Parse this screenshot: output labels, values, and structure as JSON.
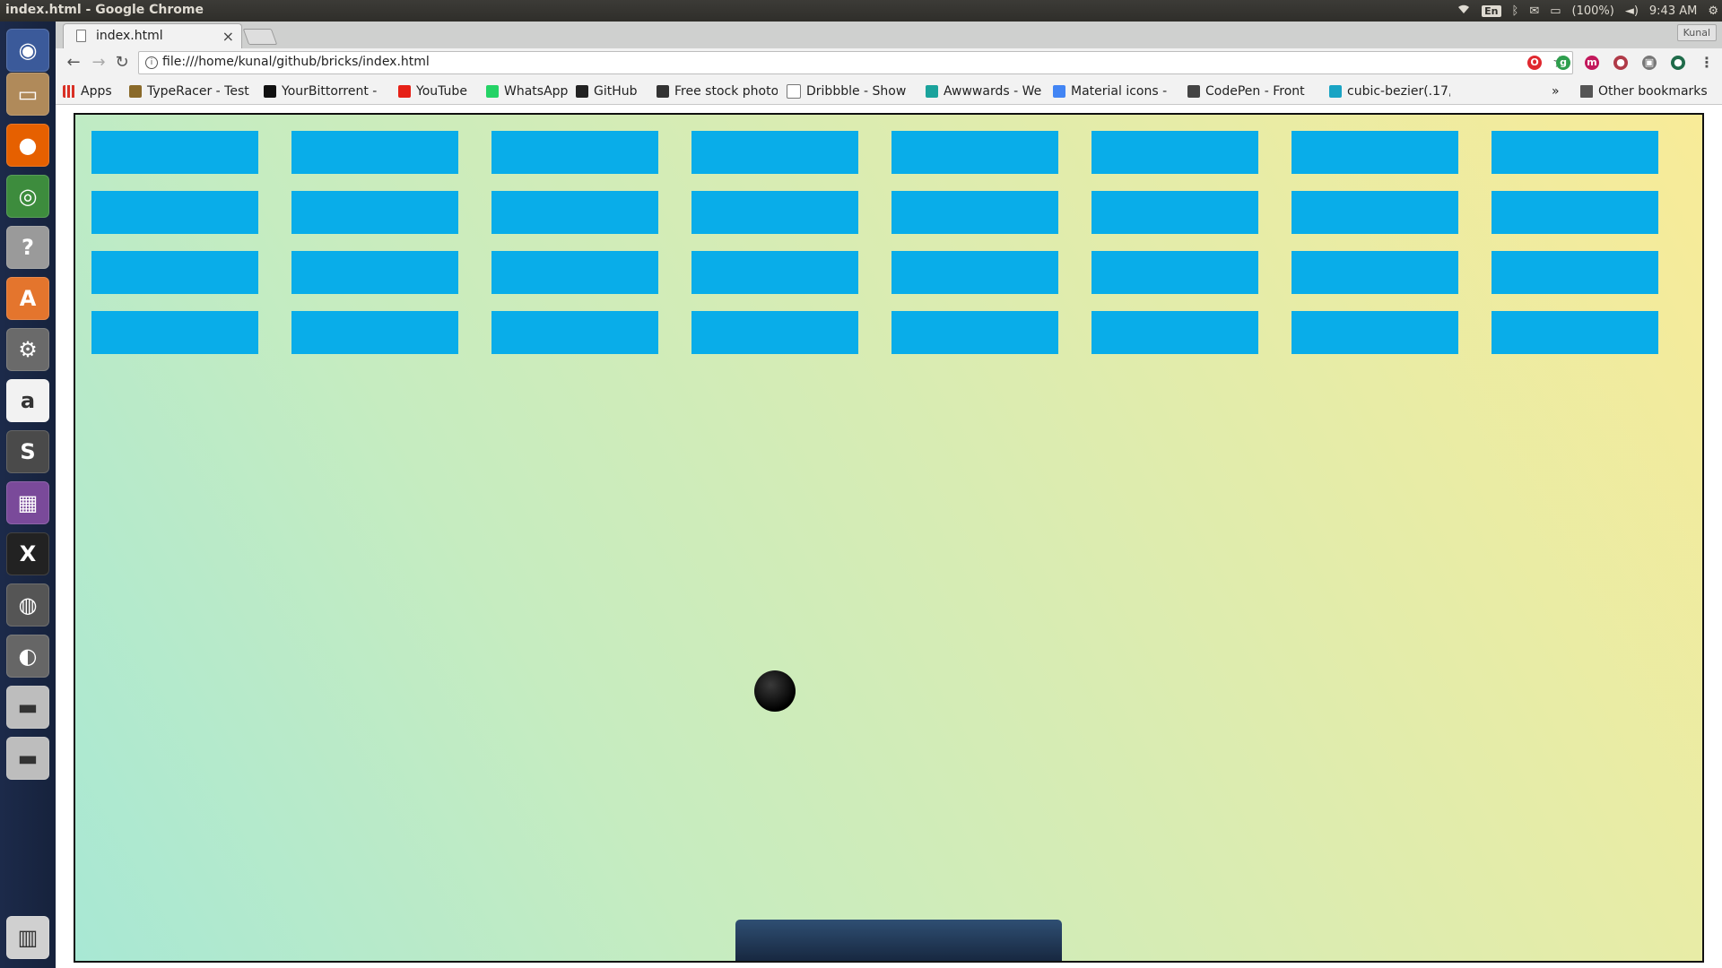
{
  "window_title": "index.html - Google Chrome",
  "system_tray": {
    "keyboard_layout": "En",
    "battery": "(100%)",
    "time": "9:43 AM",
    "user": "Kunal"
  },
  "launcher": {
    "items": [
      {
        "name": "ubuntu-dash-icon",
        "glyph": "◉",
        "color": "#3b5a9a"
      },
      {
        "name": "files-icon",
        "glyph": "▭",
        "color": "#b08a5a"
      },
      {
        "name": "firefox-icon",
        "glyph": "●",
        "color": "#e66000"
      },
      {
        "name": "chrome-icon",
        "glyph": "◎",
        "color": "#3d8c3d"
      },
      {
        "name": "help-icon",
        "glyph": "?",
        "color": "#9a9a9a"
      },
      {
        "name": "software-center-icon",
        "glyph": "A",
        "color": "#e4752d"
      },
      {
        "name": "system-settings-icon",
        "glyph": "⚙",
        "color": "#6a6a6a"
      },
      {
        "name": "amazon-icon",
        "glyph": "a",
        "color": "#f2f2f2"
      },
      {
        "name": "sublime-text-icon",
        "glyph": "S",
        "color": "#4a4a4a"
      },
      {
        "name": "video-editor-icon",
        "glyph": "▦",
        "color": "#7a4a9a"
      },
      {
        "name": "xchat-icon",
        "glyph": "X",
        "color": "#222"
      },
      {
        "name": "media-player-icon",
        "glyph": "◍",
        "color": "#555"
      },
      {
        "name": "gimp-icon",
        "glyph": "◐",
        "color": "#666"
      },
      {
        "name": "drive-1-icon",
        "glyph": "▬",
        "color": "#bdbdbd"
      },
      {
        "name": "drive-2-icon",
        "glyph": "▬",
        "color": "#bdbdbd"
      },
      {
        "name": "trash-icon",
        "glyph": "▥",
        "color": "#d0d0d0"
      }
    ]
  },
  "tab": {
    "title": "index.html",
    "close": "×"
  },
  "toolbar": {
    "back": "←",
    "forward": "→",
    "reload": "↻",
    "url": "file:///home/kunal/github/bricks/index.html",
    "star": "☆"
  },
  "extensions": [
    {
      "name": "opera-ext-icon",
      "color": "#e0282f",
      "glyph": "O"
    },
    {
      "name": "green-ext-icon",
      "color": "#2e9e4d",
      "glyph": "g"
    },
    {
      "name": "mendeley-ext-icon",
      "color": "#c2185b",
      "glyph": "m"
    },
    {
      "name": "colorful-ext-icon",
      "color": "#b03a48",
      "glyph": "●"
    },
    {
      "name": "gray-ext-icon",
      "color": "#777777",
      "glyph": "▣"
    },
    {
      "name": "dark-ext-icon",
      "color": "#1f6b4a",
      "glyph": "●"
    },
    {
      "name": "menu-icon",
      "color": "#f2f2f2",
      "glyph": "⋮"
    }
  ],
  "bookmarks": {
    "apps": "Apps",
    "items": [
      {
        "label": "TypeRacer - Test",
        "color": "#8a6a2a"
      },
      {
        "label": "YourBittorrent -",
        "color": "#111111"
      },
      {
        "label": "YouTube",
        "color": "#e62117"
      },
      {
        "label": "WhatsApp",
        "color": "#25d366"
      },
      {
        "label": "GitHub",
        "color": "#222222"
      },
      {
        "label": "Free stock photo",
        "color": "#333333"
      },
      {
        "label": "Dribbble - Show",
        "color": "#ffffff"
      },
      {
        "label": "Awwwards - We",
        "color": "#1ba39c"
      },
      {
        "label": "Material icons -",
        "color": "#4285f4"
      },
      {
        "label": "CodePen - Front",
        "color": "#444444"
      },
      {
        "label": "cubic-bezier(.17,",
        "color": "#1aa4c4"
      }
    ],
    "overflow": "»",
    "other": "Other bookmarks"
  },
  "game": {
    "brick_color": "#09ade9",
    "rows": 4,
    "columns": 8,
    "remaining_bricks": 32,
    "ball_color": "#000000",
    "paddle_color": "#1e3655"
  }
}
